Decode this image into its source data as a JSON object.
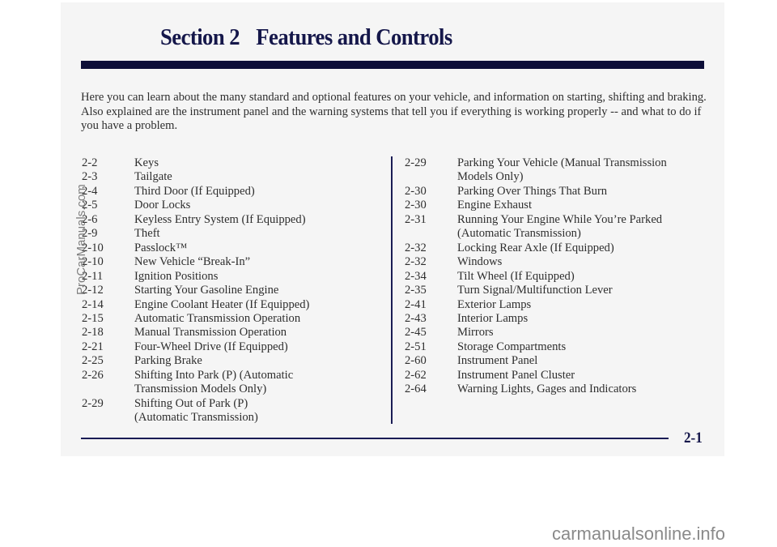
{
  "header": {
    "section": "Section 2",
    "title": "Features and Controls"
  },
  "intro": "Here you can learn about the many standard and optional features on your vehicle, and information on starting, shifting and braking. Also explained are the instrument panel and the warning systems that tell you if everything is working properly -- and what to do if you have a problem.",
  "toc_left": [
    {
      "page": "2-2",
      "label": "Keys"
    },
    {
      "page": "2-3",
      "label": "Tailgate"
    },
    {
      "page": "2-4",
      "label": "Third Door (If Equipped)"
    },
    {
      "page": "2-5",
      "label": "Door Locks"
    },
    {
      "page": "2-6",
      "label": "Keyless Entry System (If Equipped)"
    },
    {
      "page": "2-9",
      "label": "Theft"
    },
    {
      "page": "2-10",
      "label": "Passlock™"
    },
    {
      "page": "2-10",
      "label": "New Vehicle “Break-In”"
    },
    {
      "page": "2-11",
      "label": "Ignition Positions"
    },
    {
      "page": "2-12",
      "label": "Starting Your Gasoline Engine"
    },
    {
      "page": "2-14",
      "label": "Engine Coolant Heater (If Equipped)"
    },
    {
      "page": "2-15",
      "label": "Automatic Transmission Operation"
    },
    {
      "page": "2-18",
      "label": "Manual Transmission Operation"
    },
    {
      "page": "2-21",
      "label": "Four-Wheel Drive (If Equipped)"
    },
    {
      "page": "2-25",
      "label": "Parking Brake"
    },
    {
      "page": "2-26",
      "label": "Shifting Into Park (P) (Automatic Transmission Models Only)"
    },
    {
      "page": "2-29",
      "label": "Shifting Out of Park (P) (Automatic Transmission)"
    }
  ],
  "toc_right": [
    {
      "page": "2-29",
      "label": "Parking Your Vehicle (Manual Transmission Models Only)"
    },
    {
      "page": "2-30",
      "label": "Parking Over Things That Burn"
    },
    {
      "page": "2-30",
      "label": "Engine Exhaust"
    },
    {
      "page": "2-31",
      "label": "Running Your Engine While You’re Parked (Automatic Transmission)"
    },
    {
      "page": "2-32",
      "label": "Locking Rear Axle (If Equipped)"
    },
    {
      "page": "2-32",
      "label": "Windows"
    },
    {
      "page": "2-34",
      "label": "Tilt Wheel (If Equipped)"
    },
    {
      "page": "2-35",
      "label": "Turn Signal/Multifunction Lever"
    },
    {
      "page": "2-41",
      "label": "Exterior Lamps"
    },
    {
      "page": "2-43",
      "label": "Interior Lamps"
    },
    {
      "page": "2-45",
      "label": "Mirrors"
    },
    {
      "page": "2-51",
      "label": "Storage Compartments"
    },
    {
      "page": "2-60",
      "label": "Instrument Panel"
    },
    {
      "page": "2-62",
      "label": "Instrument Panel Cluster"
    },
    {
      "page": "2-64",
      "label": "Warning Lights, Gages and Indicators"
    }
  ],
  "footer": {
    "page_number": "2-1"
  },
  "watermarks": {
    "vertical": "ProCarManuals.com",
    "bottom": "carmanualsonline.info"
  }
}
